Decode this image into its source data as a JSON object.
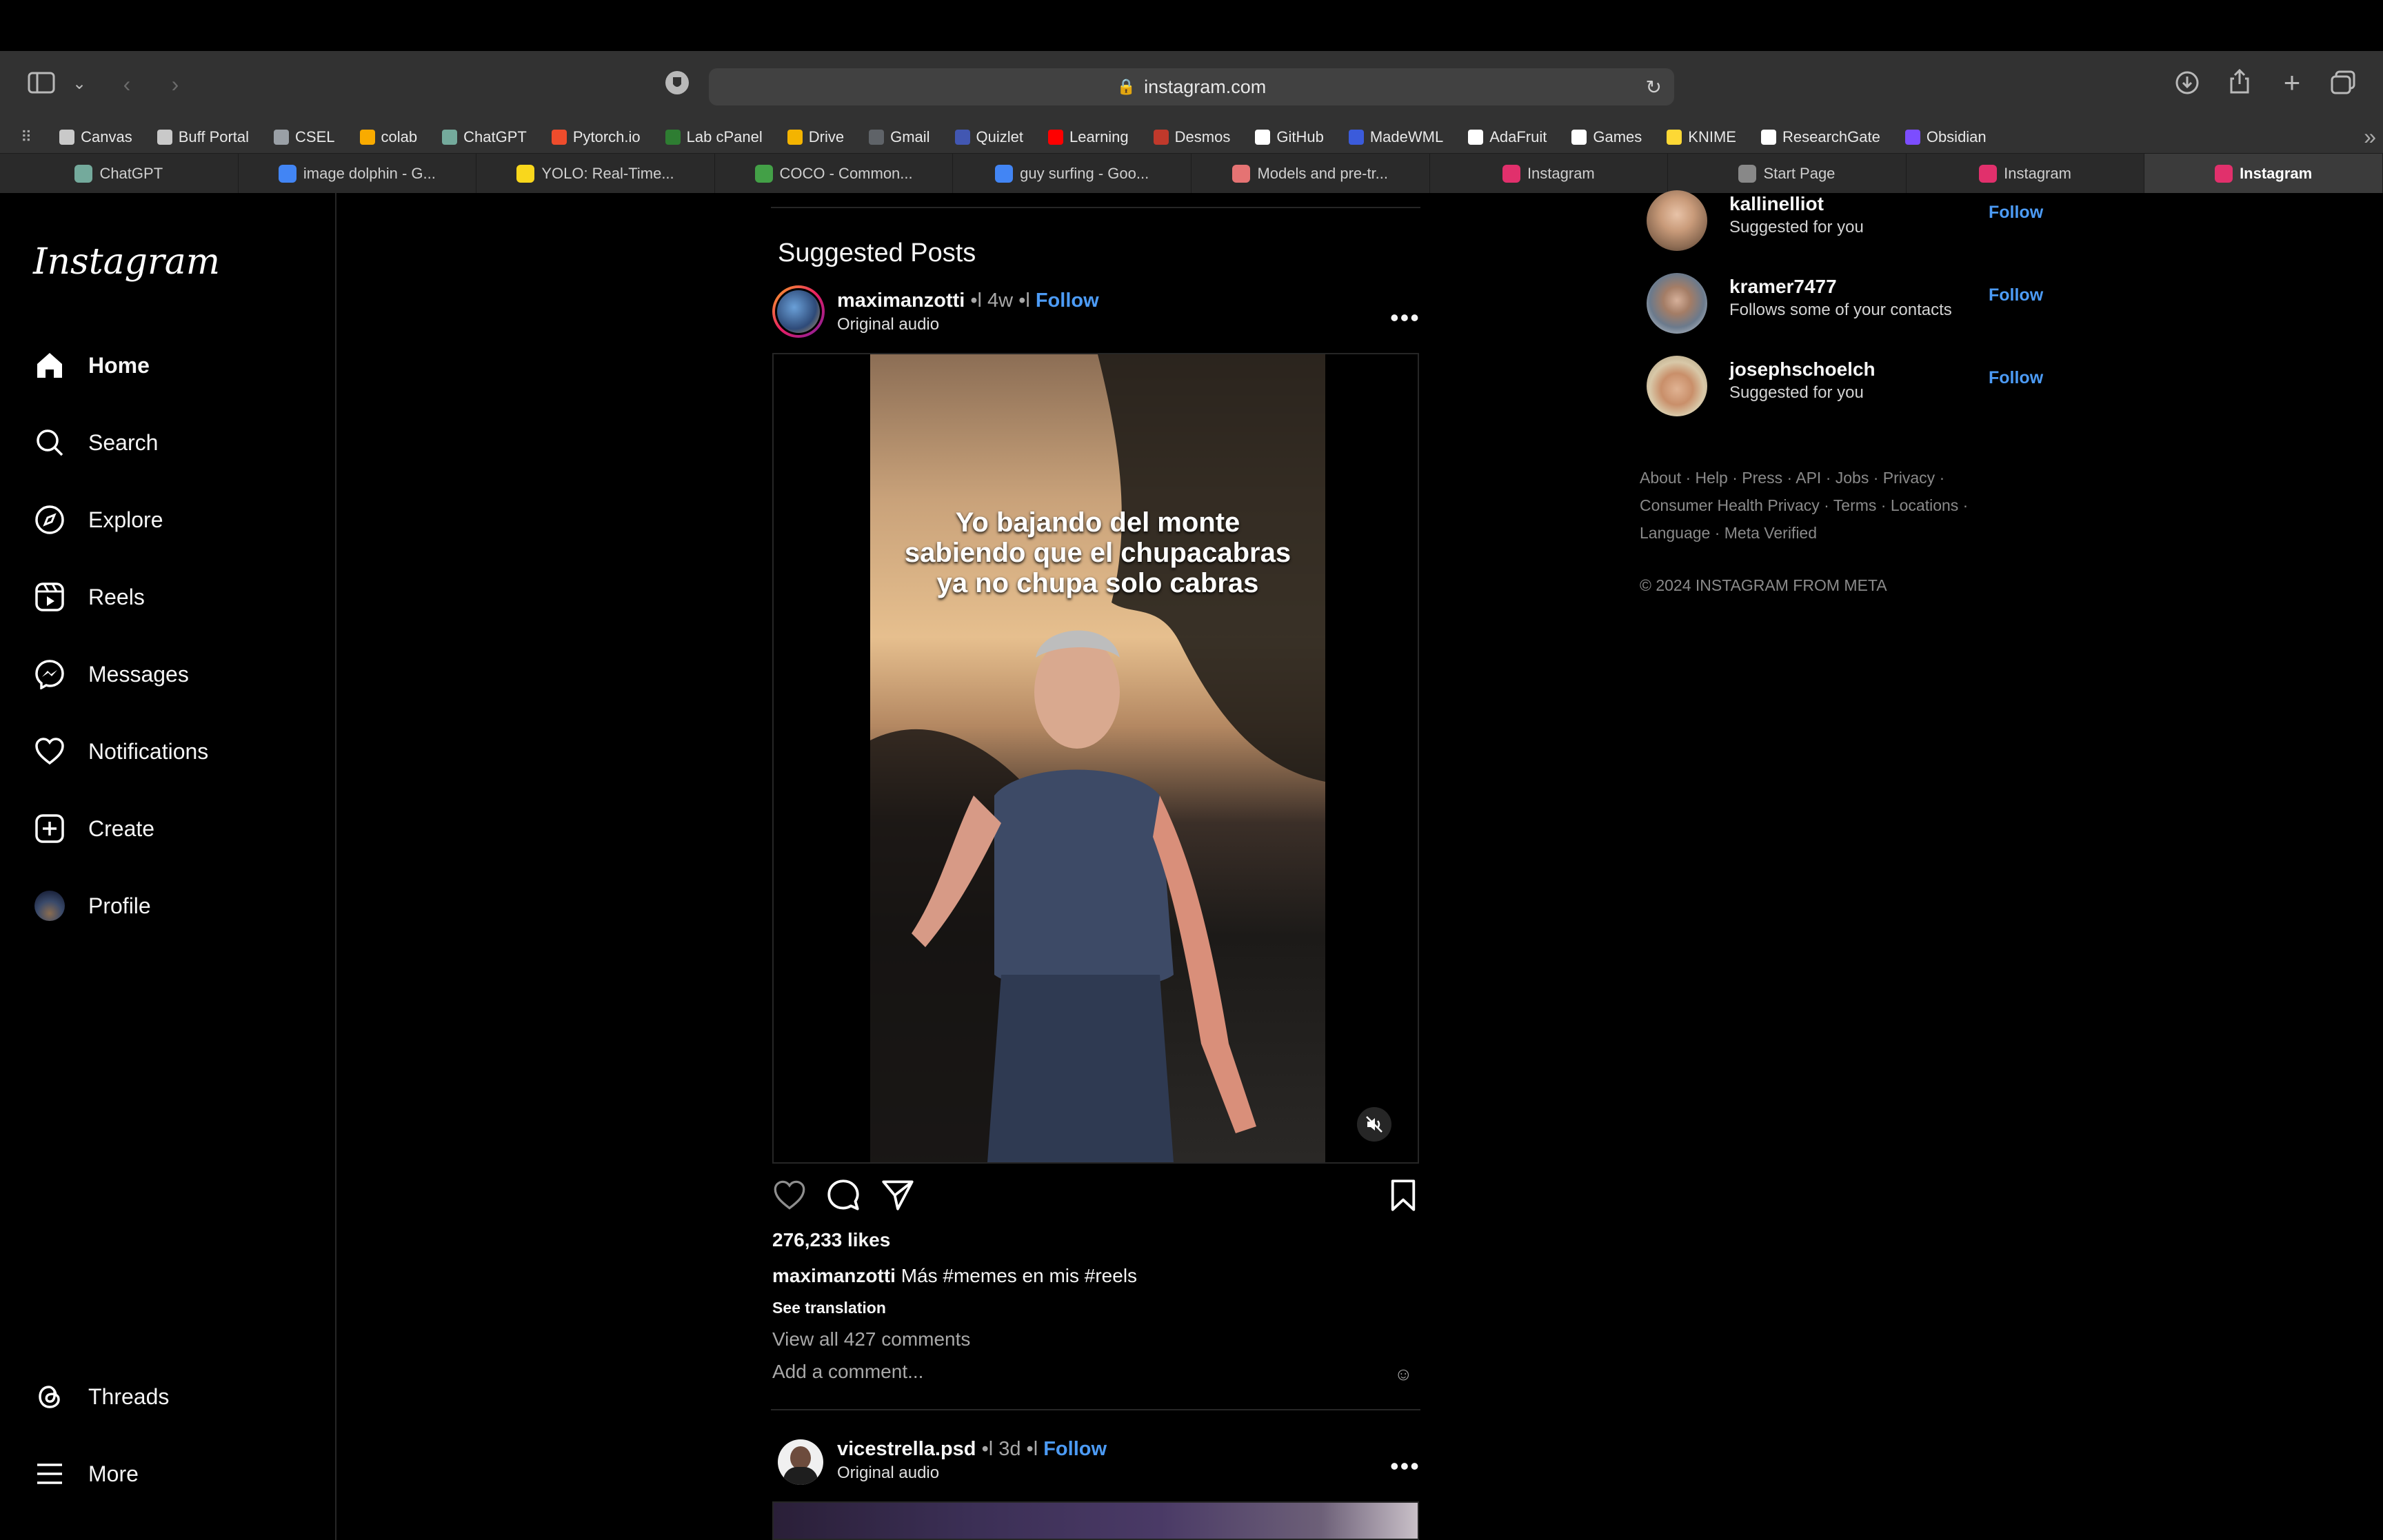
{
  "browser": {
    "url": "instagram.com",
    "bookmarks": [
      "Canvas",
      "Buff Portal",
      "CSEL",
      "colab",
      "ChatGPT",
      "Pytorch.io",
      "Lab cPanel",
      "Drive",
      "Gmail",
      "Quizlet",
      "Learning",
      "Desmos",
      "GitHub",
      "MadeWML",
      "AdaFruit",
      "Games",
      "KNIME",
      "ResearchGate",
      "Obsidian"
    ],
    "tabs": [
      "ChatGPT",
      "image dolphin - G...",
      "YOLO: Real-Time...",
      "COCO - Common...",
      "guy surfing - Goo...",
      "Models and pre-tr...",
      "Instagram",
      "Start Page",
      "Instagram",
      "Instagram"
    ],
    "active_tab": 9
  },
  "sidebar": {
    "logo": "Instagram",
    "items": [
      "Home",
      "Search",
      "Explore",
      "Reels",
      "Messages",
      "Notifications",
      "Create",
      "Profile"
    ],
    "bottom": [
      "Threads",
      "More"
    ]
  },
  "feed": {
    "section_title": "Suggested Posts",
    "post": {
      "username": "maximanzotti",
      "time": "4w",
      "follow": "Follow",
      "audio": "Original audio",
      "video_caption": [
        "Yo bajando del monte",
        "sabiendo que el chupacabras",
        "ya no chupa solo cabras"
      ],
      "likes": "276,233 likes",
      "caption_user": "maximanzotti",
      "caption_text": "Más #memes en mis #reels",
      "see_translation": "See translation",
      "comments": "View all 427 comments",
      "add_comment": "Add a comment..."
    },
    "next_post": {
      "username": "vicestrella.psd",
      "time": "3d",
      "follow": "Follow",
      "audio": "Original audio"
    }
  },
  "suggestions": [
    {
      "name": "kallinelliot",
      "sub": "Suggested for you",
      "follow": "Follow"
    },
    {
      "name": "kramer7477",
      "sub": "Follows some of your contacts",
      "follow": "Follow"
    },
    {
      "name": "josephschoelch",
      "sub": "Suggested for you",
      "follow": "Follow"
    }
  ],
  "footer": {
    "line1": "About · Help · Press · API · Jobs · Privacy ·",
    "line2": "Consumer Health Privacy · Terms · Locations ·",
    "line3": "Language · Meta Verified",
    "copyright": "© 2024 INSTAGRAM FROM META"
  },
  "colors": {
    "link": "#4c9bf5",
    "bg": "#000000"
  }
}
